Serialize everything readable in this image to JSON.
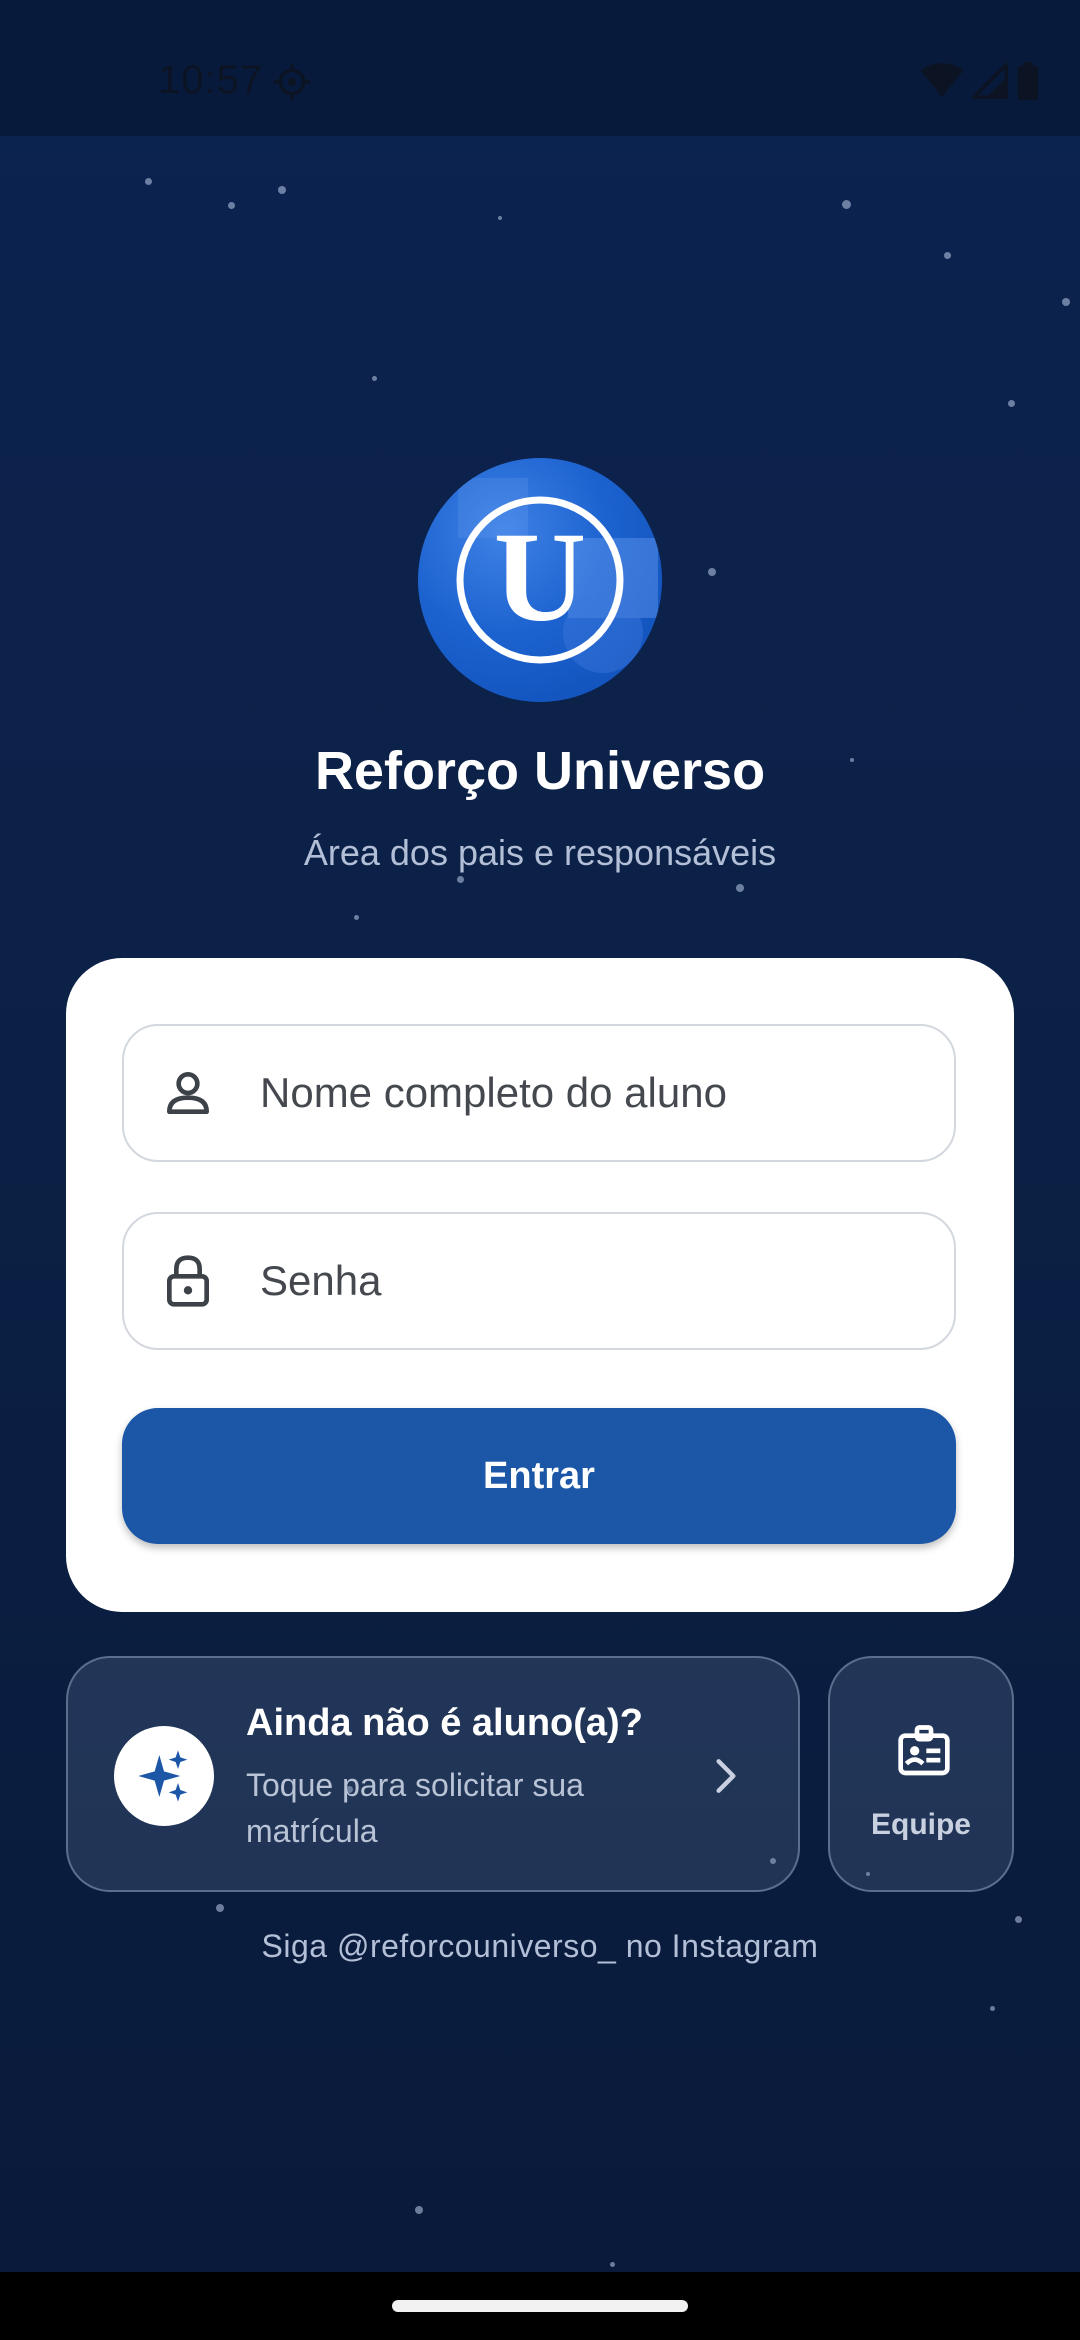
{
  "status_bar": {
    "time": "10:57"
  },
  "app": {
    "logo_letter": "U",
    "title": "Reforço Universo",
    "subtitle": "Área dos pais e responsáveis"
  },
  "login": {
    "name_placeholder": "Nome completo do aluno",
    "name_value": "",
    "password_placeholder": "Senha",
    "password_value": "",
    "submit_label": "Entrar"
  },
  "enroll": {
    "title": "Ainda não é aluno(a)?",
    "description": "Toque para solicitar sua matrícula"
  },
  "team": {
    "label": "Equipe"
  },
  "footer": {
    "instagram_text": "Siga @reforcouniverso_ no Instagram"
  },
  "icons": {
    "name_field": "person-icon",
    "password_field": "lock-icon",
    "enroll": "sparkles-icon",
    "enroll_arrow": "chevron-right-icon",
    "team": "badge-icon"
  },
  "colors": {
    "background": "#0c2147",
    "primary_button": "#1b57a6",
    "logo_blue": "#1c62cf",
    "card": "#ffffff"
  }
}
